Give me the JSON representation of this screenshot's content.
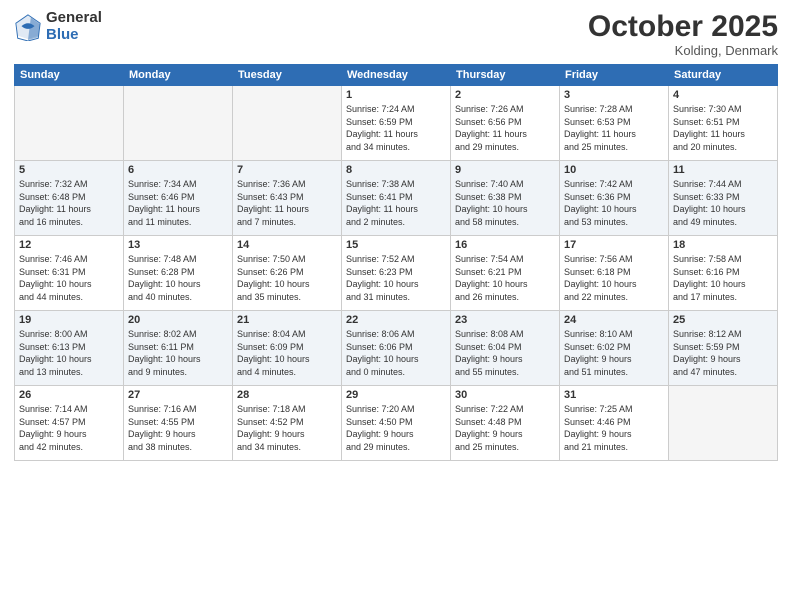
{
  "header": {
    "logo_general": "General",
    "logo_blue": "Blue",
    "month": "October 2025",
    "location": "Kolding, Denmark"
  },
  "days_of_week": [
    "Sunday",
    "Monday",
    "Tuesday",
    "Wednesday",
    "Thursday",
    "Friday",
    "Saturday"
  ],
  "weeks": [
    {
      "shaded": false,
      "days": [
        {
          "num": "",
          "info": ""
        },
        {
          "num": "",
          "info": ""
        },
        {
          "num": "",
          "info": ""
        },
        {
          "num": "1",
          "info": "Sunrise: 7:24 AM\nSunset: 6:59 PM\nDaylight: 11 hours\nand 34 minutes."
        },
        {
          "num": "2",
          "info": "Sunrise: 7:26 AM\nSunset: 6:56 PM\nDaylight: 11 hours\nand 29 minutes."
        },
        {
          "num": "3",
          "info": "Sunrise: 7:28 AM\nSunset: 6:53 PM\nDaylight: 11 hours\nand 25 minutes."
        },
        {
          "num": "4",
          "info": "Sunrise: 7:30 AM\nSunset: 6:51 PM\nDaylight: 11 hours\nand 20 minutes."
        }
      ]
    },
    {
      "shaded": true,
      "days": [
        {
          "num": "5",
          "info": "Sunrise: 7:32 AM\nSunset: 6:48 PM\nDaylight: 11 hours\nand 16 minutes."
        },
        {
          "num": "6",
          "info": "Sunrise: 7:34 AM\nSunset: 6:46 PM\nDaylight: 11 hours\nand 11 minutes."
        },
        {
          "num": "7",
          "info": "Sunrise: 7:36 AM\nSunset: 6:43 PM\nDaylight: 11 hours\nand 7 minutes."
        },
        {
          "num": "8",
          "info": "Sunrise: 7:38 AM\nSunset: 6:41 PM\nDaylight: 11 hours\nand 2 minutes."
        },
        {
          "num": "9",
          "info": "Sunrise: 7:40 AM\nSunset: 6:38 PM\nDaylight: 10 hours\nand 58 minutes."
        },
        {
          "num": "10",
          "info": "Sunrise: 7:42 AM\nSunset: 6:36 PM\nDaylight: 10 hours\nand 53 minutes."
        },
        {
          "num": "11",
          "info": "Sunrise: 7:44 AM\nSunset: 6:33 PM\nDaylight: 10 hours\nand 49 minutes."
        }
      ]
    },
    {
      "shaded": false,
      "days": [
        {
          "num": "12",
          "info": "Sunrise: 7:46 AM\nSunset: 6:31 PM\nDaylight: 10 hours\nand 44 minutes."
        },
        {
          "num": "13",
          "info": "Sunrise: 7:48 AM\nSunset: 6:28 PM\nDaylight: 10 hours\nand 40 minutes."
        },
        {
          "num": "14",
          "info": "Sunrise: 7:50 AM\nSunset: 6:26 PM\nDaylight: 10 hours\nand 35 minutes."
        },
        {
          "num": "15",
          "info": "Sunrise: 7:52 AM\nSunset: 6:23 PM\nDaylight: 10 hours\nand 31 minutes."
        },
        {
          "num": "16",
          "info": "Sunrise: 7:54 AM\nSunset: 6:21 PM\nDaylight: 10 hours\nand 26 minutes."
        },
        {
          "num": "17",
          "info": "Sunrise: 7:56 AM\nSunset: 6:18 PM\nDaylight: 10 hours\nand 22 minutes."
        },
        {
          "num": "18",
          "info": "Sunrise: 7:58 AM\nSunset: 6:16 PM\nDaylight: 10 hours\nand 17 minutes."
        }
      ]
    },
    {
      "shaded": true,
      "days": [
        {
          "num": "19",
          "info": "Sunrise: 8:00 AM\nSunset: 6:13 PM\nDaylight: 10 hours\nand 13 minutes."
        },
        {
          "num": "20",
          "info": "Sunrise: 8:02 AM\nSunset: 6:11 PM\nDaylight: 10 hours\nand 9 minutes."
        },
        {
          "num": "21",
          "info": "Sunrise: 8:04 AM\nSunset: 6:09 PM\nDaylight: 10 hours\nand 4 minutes."
        },
        {
          "num": "22",
          "info": "Sunrise: 8:06 AM\nSunset: 6:06 PM\nDaylight: 10 hours\nand 0 minutes."
        },
        {
          "num": "23",
          "info": "Sunrise: 8:08 AM\nSunset: 6:04 PM\nDaylight: 9 hours\nand 55 minutes."
        },
        {
          "num": "24",
          "info": "Sunrise: 8:10 AM\nSunset: 6:02 PM\nDaylight: 9 hours\nand 51 minutes."
        },
        {
          "num": "25",
          "info": "Sunrise: 8:12 AM\nSunset: 5:59 PM\nDaylight: 9 hours\nand 47 minutes."
        }
      ]
    },
    {
      "shaded": false,
      "days": [
        {
          "num": "26",
          "info": "Sunrise: 7:14 AM\nSunset: 4:57 PM\nDaylight: 9 hours\nand 42 minutes."
        },
        {
          "num": "27",
          "info": "Sunrise: 7:16 AM\nSunset: 4:55 PM\nDaylight: 9 hours\nand 38 minutes."
        },
        {
          "num": "28",
          "info": "Sunrise: 7:18 AM\nSunset: 4:52 PM\nDaylight: 9 hours\nand 34 minutes."
        },
        {
          "num": "29",
          "info": "Sunrise: 7:20 AM\nSunset: 4:50 PM\nDaylight: 9 hours\nand 29 minutes."
        },
        {
          "num": "30",
          "info": "Sunrise: 7:22 AM\nSunset: 4:48 PM\nDaylight: 9 hours\nand 25 minutes."
        },
        {
          "num": "31",
          "info": "Sunrise: 7:25 AM\nSunset: 4:46 PM\nDaylight: 9 hours\nand 21 minutes."
        },
        {
          "num": "",
          "info": ""
        }
      ]
    }
  ]
}
